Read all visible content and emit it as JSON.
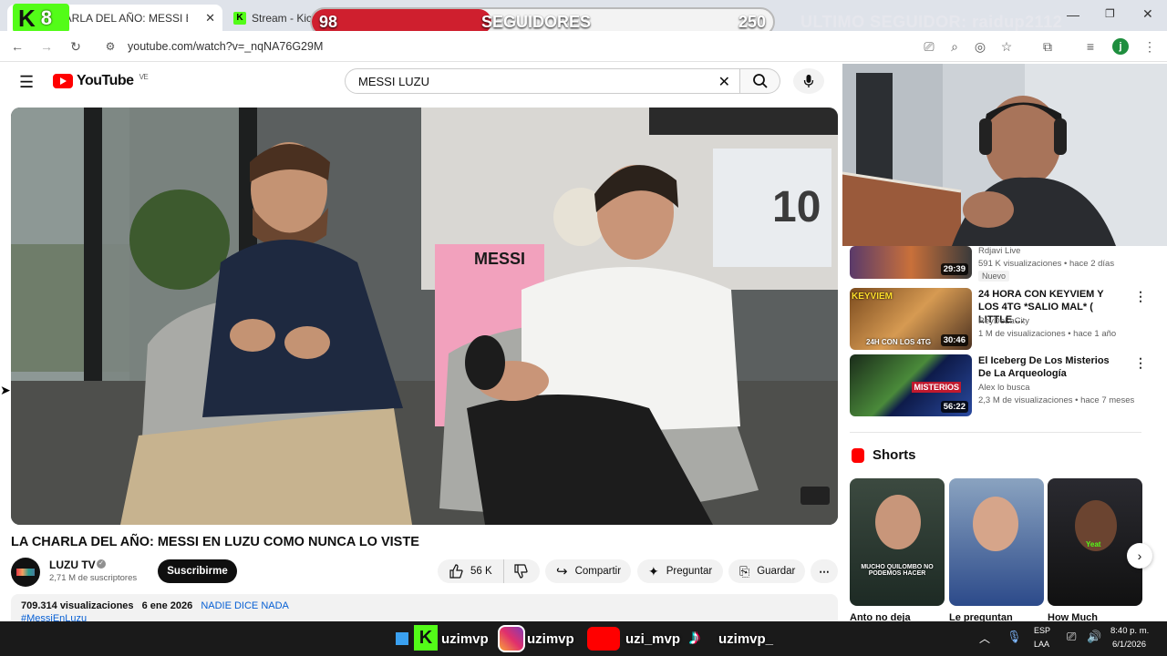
{
  "browser": {
    "tabs": [
      {
        "label": "LA CHARLA DEL AÑO: MESSI EN"
      },
      {
        "label": "Stream - Kick"
      }
    ],
    "new_tab": "+",
    "url": "youtube.com/watch?v=_nqNA76G29M",
    "profile_initial": "j"
  },
  "overlay": {
    "kick_count": "8",
    "current_followers": "98",
    "followers_label": "SEGUIDORES",
    "follower_goal": "250",
    "progress_fraction": 0.39,
    "last_follower": "ULTIMO SEGUIDOR: raidup2112"
  },
  "youtube": {
    "logo": "YouTube",
    "region": "VE",
    "search_value": "MESSI LUZU"
  },
  "video": {
    "title": "LA CHARLA DEL AÑO: MESSI EN LUZU COMO NUNCA LO VISTE",
    "channel": "LUZU TV",
    "subscribers": "2,71 M de suscriptores",
    "subscribe_label": "Suscribirme",
    "likes": "56 K",
    "share_label": "Compartir",
    "ask_label": "Preguntar",
    "save_label": "Guardar",
    "views": "709.314 visualizaciones",
    "date": "6 ene 2026",
    "hashtag": "NADIE DICE NADA",
    "hashtag2": "#MessiEnLuzu",
    "jersey_text": "MESSI",
    "jersey_number": "10"
  },
  "related": [
    {
      "channel": "Rdjavi Live",
      "meta": "591 K visualizaciones • hace 2 días",
      "badge": "Nuevo",
      "duration": "29:39"
    },
    {
      "title": "24 HORA CON KEYVIEM Y LOS 4TG *SALIO MAL* ( LITTLE ...",
      "channel": "ReyDeLaCity",
      "meta": "1 M de visualizaciones • hace 1 año",
      "duration": "30:46",
      "thumb_text": "KEYVIEM",
      "thumb_sub": "24H CON LOS 4TG"
    },
    {
      "title": "El Iceberg De Los Misterios De La Arqueología",
      "channel": "Alex lo busca",
      "meta": "2,3 M de visualizaciones • hace 7 meses",
      "duration": "56:22",
      "thumb_text": "MISTERIOS"
    }
  ],
  "shorts": {
    "heading": "Shorts",
    "items": [
      {
        "title": "Anto no deja",
        "caption": "MUCHO QUILOMBO NO PODEMOS HACER"
      },
      {
        "title": "Le preguntan"
      },
      {
        "title": "How Much",
        "caption": "Yeat"
      }
    ]
  },
  "taskbar": {
    "handles": [
      "uzimvp",
      "uzimvp",
      "uzi_mvp",
      "uzimvp_"
    ],
    "lang": "ESP",
    "lang2": "LAA",
    "time": "8:40 p. m.",
    "date": "6/1/2026"
  },
  "colors": {
    "youtube_red": "#ff0000",
    "kick_green": "#53fc18",
    "follow_red": "#cf1f2e"
  }
}
